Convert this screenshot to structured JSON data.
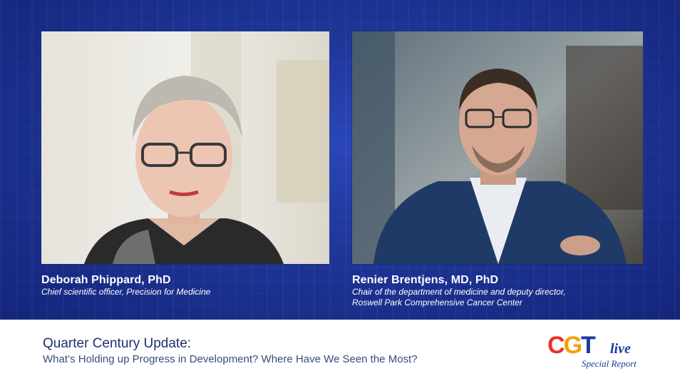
{
  "speakers": [
    {
      "name": "Deborah Phippard, PhD",
      "role_lines": [
        "Chief scientific officer, Precision for Medicine"
      ]
    },
    {
      "name": "Renier Brentjens, MD, PhD",
      "role_lines": [
        "Chair of the department of medicine and deputy director,",
        "Roswell Park Comprehensive Cancer Center"
      ]
    }
  ],
  "lower_third": {
    "headline": "Quarter Century Update:",
    "subline": "What’s Holding up Progress in Development? Where Have We Seen the Most?"
  },
  "logo": {
    "brand_c": "C",
    "brand_g": "G",
    "brand_t": "T",
    "brand_live": "live",
    "tagline": "Special Report",
    "colors": {
      "c": "#e8322b",
      "g": "#f4a100",
      "t": "#1a3c9c"
    }
  },
  "colors": {
    "background": "#1e3597",
    "caption_text": "#ffffff",
    "headline_text": "#1f2f74"
  }
}
